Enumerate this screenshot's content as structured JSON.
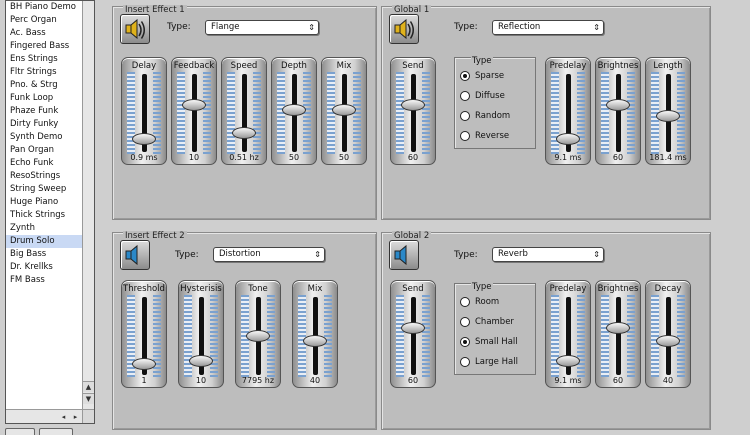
{
  "presets": [
    "BH Piano Demo",
    "Perc Organ",
    "Ac. Bass",
    "Fingered Bass",
    "Ens Strings",
    "Fltr Strings",
    "Pno. & Strg",
    "Funk Loop",
    "Phaze Funk",
    "Dirty Funky",
    "Synth Demo",
    "Pan Organ",
    "Echo Funk",
    "ResoStrings",
    "String Sweep",
    "Huge Piano",
    "Thick Strings",
    "Zynth",
    "Drum Solo",
    "Big Bass",
    "Dr. Krellks",
    "FM Bass"
  ],
  "selected_preset": "Drum Solo",
  "list_scroll": {
    "up": "▲",
    "down": "▼",
    "left": "◂",
    "right": "▸"
  },
  "colors": {
    "slider_meter": "#7aa1cf",
    "selection": "#c9d9f4",
    "panel": "#bdbdbd"
  },
  "insert1": {
    "title": "Insert Effect 1",
    "type_label": "Type:",
    "type_value": "Flange",
    "icon": "speaker-on-icon",
    "sliders": [
      {
        "label": "Delay",
        "value": "0.9 ms",
        "level": 0.1
      },
      {
        "label": "Feedback",
        "value": "10",
        "level": 0.62
      },
      {
        "label": "Speed",
        "value": "0.51 hz",
        "level": 0.2
      },
      {
        "label": "Depth",
        "value": "50",
        "level": 0.55
      },
      {
        "label": "Mix",
        "value": "50",
        "level": 0.55
      }
    ]
  },
  "global1": {
    "title": "Global 1",
    "type_label": "Type:",
    "type_value": "Reflection",
    "icon": "speaker-on-icon",
    "sliders_left": [
      {
        "label": "Send",
        "value": "60",
        "level": 0.62
      }
    ],
    "radio_title": "Type",
    "radios": [
      {
        "label": "Sparse",
        "checked": true
      },
      {
        "label": "Diffuse",
        "checked": false
      },
      {
        "label": "Random",
        "checked": false
      },
      {
        "label": "Reverse",
        "checked": false
      }
    ],
    "sliders_right": [
      {
        "label": "Predelay",
        "value": "9.1 ms",
        "level": 0.1
      },
      {
        "label": "Brightnes",
        "value": "60",
        "level": 0.62
      },
      {
        "label": "Length",
        "value": "181.4 ms",
        "level": 0.45
      }
    ]
  },
  "insert2": {
    "title": "Insert Effect 2",
    "type_label": "Type:",
    "type_value": "Distortion",
    "icon": "speaker-off-icon",
    "sliders": [
      {
        "label": "Threshold",
        "value": "1",
        "level": 0.08
      },
      {
        "label": "Hysterisis",
        "value": "10",
        "level": 0.12
      },
      {
        "label": "Tone",
        "value": "7795 hz",
        "level": 0.5
      },
      {
        "label": "Mix",
        "value": "40",
        "level": 0.42
      }
    ]
  },
  "global2": {
    "title": "Global 2",
    "type_label": "Type:",
    "type_value": "Reverb",
    "icon": "speaker-off-icon",
    "sliders_left": [
      {
        "label": "Send",
        "value": "60",
        "level": 0.62
      }
    ],
    "radio_title": "Type",
    "radios": [
      {
        "label": "Room",
        "checked": false
      },
      {
        "label": "Chamber",
        "checked": false
      },
      {
        "label": "Small Hall",
        "checked": true
      },
      {
        "label": "Large Hall",
        "checked": false
      }
    ],
    "sliders_right": [
      {
        "label": "Predelay",
        "value": "9.1 ms",
        "level": 0.12
      },
      {
        "label": "Brightnes",
        "value": "60",
        "level": 0.62
      },
      {
        "label": "Decay",
        "value": "40",
        "level": 0.42
      }
    ]
  }
}
